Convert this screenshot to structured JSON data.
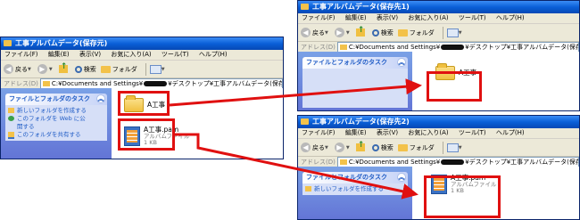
{
  "menu": [
    "ファイル(F)",
    "編集(E)",
    "表示(V)",
    "お気に入り(A)",
    "ツール(T)",
    "ヘルプ(H)"
  ],
  "toolbar": {
    "back": "戻る",
    "search": "検索",
    "folders": "フォルダ"
  },
  "address_label": "アドレス(D)",
  "source_window": {
    "title": "工事アルバムデータ(保存元)",
    "address_start": "C:¥Documents and Settings¥",
    "address_end": "¥デスクトップ¥工事アルバムデータ(保存元)",
    "task_header": "ファイルとフォルダのタスク",
    "tasks": [
      "新しいフォルダを作成する",
      "このフォルダを Web に公開する",
      "このフォルダを共有する"
    ],
    "folder_name": "A工事",
    "file_name": "A工事.pam",
    "file_type": "アルバムファイル",
    "file_size": "1 KB"
  },
  "dest1_window": {
    "title": "工事アルバムデータ(保存先1)",
    "address_start": "C:¥Documents and Settings¥",
    "address_end": "¥デスクトップ¥工事アルバムデータ(保存先1)",
    "task_header": "ファイルとフォルダのタスク",
    "folder_name": "A工事"
  },
  "dest2_window": {
    "title": "工事アルバムデータ(保存先2)",
    "address_start": "C:¥Documents and Settings¥",
    "address_end": "¥デスクトップ¥工事アルバムデータ(保存先2)",
    "task_header": "ファイルとフォルダのタスク",
    "tasks": [
      "新しいフォルダを作成する"
    ],
    "file_name": "A工事.pam",
    "file_type": "アルバムファイル",
    "file_size": "1 KB"
  },
  "colors": {
    "highlight": "#e01010",
    "titlebar": "#0a5fd8",
    "taskpane": "#7aa1e6"
  }
}
